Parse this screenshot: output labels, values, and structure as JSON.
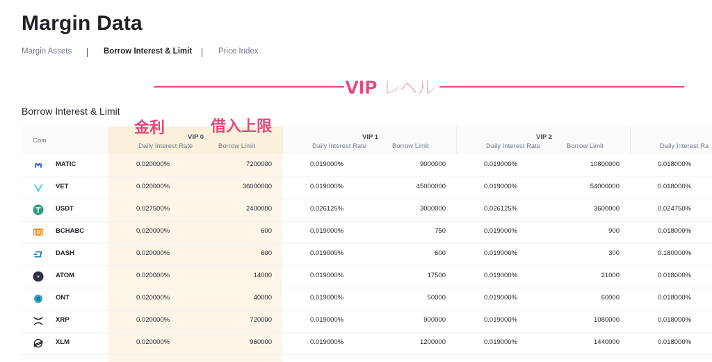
{
  "page": {
    "title": "Margin Data"
  },
  "subnav": [
    {
      "label": "Margin Assets",
      "active": false
    },
    {
      "label": "Borrow Interest & Limit",
      "active": true
    },
    {
      "label": "Price Index",
      "active": false
    }
  ],
  "annotations": {
    "vip_level": "VIP レベル",
    "interest": "金利",
    "borrow_limit": "借入上限",
    "color": "#e8467c"
  },
  "section": {
    "title": "Borrow Interest & Limit"
  },
  "table": {
    "coin_header": "Coin",
    "tiers": [
      {
        "name": "VIP 0",
        "rate_label": "Daily Interest Rate",
        "limit_label": "Borrow Limit",
        "highlight_color": "#fdf6e8"
      },
      {
        "name": "VIP 1",
        "rate_label": "Daily Interest Rate",
        "limit_label": "Borrow Limit"
      },
      {
        "name": "VIP 2",
        "rate_label": "Daily Interest Rate",
        "limit_label": "Borrow Limit"
      },
      {
        "name": "",
        "rate_label": "Daily Interest Ra",
        "limit_label": ""
      }
    ],
    "rows": [
      {
        "coin": "MATIC",
        "icon": "matic-icon",
        "color": "#2b6def",
        "vip0_rate": "0.020000%",
        "vip0_limit": "7200000",
        "vip1_rate": "0.019000%",
        "vip1_limit": "9000000",
        "vip2_rate": "0.019000%",
        "vip2_limit": "10800000",
        "vip3_rate": "0.018000%"
      },
      {
        "coin": "VET",
        "icon": "vet-icon",
        "color": "#15bdff",
        "vip0_rate": "0.020000%",
        "vip0_limit": "36000000",
        "vip1_rate": "0.019000%",
        "vip1_limit": "45000000",
        "vip2_rate": "0.019000%",
        "vip2_limit": "54000000",
        "vip3_rate": "0.018000%"
      },
      {
        "coin": "USDT",
        "icon": "usdt-icon",
        "color": "#26a17b",
        "vip0_rate": "0.027500%",
        "vip0_limit": "2400000",
        "vip1_rate": "0.026125%",
        "vip1_limit": "3000000",
        "vip2_rate": "0.026125%",
        "vip2_limit": "3600000",
        "vip3_rate": "0.024750%"
      },
      {
        "coin": "BCHABC",
        "icon": "bchabc-icon",
        "color": "#f0861a",
        "vip0_rate": "0.020000%",
        "vip0_limit": "600",
        "vip1_rate": "0.019000%",
        "vip1_limit": "750",
        "vip2_rate": "0.019000%",
        "vip2_limit": "900",
        "vip3_rate": "0.018000%"
      },
      {
        "coin": "DASH",
        "icon": "dash-icon",
        "color": "#1c75bc",
        "vip0_rate": "0.020000%",
        "vip0_limit": "600",
        "vip1_rate": "0.019000%",
        "vip1_limit": "600",
        "vip2_rate": "0.019000%",
        "vip2_limit": "300",
        "vip3_rate": "0.180000%"
      },
      {
        "coin": "ATOM",
        "icon": "atom-icon",
        "color": "#2e3148",
        "vip0_rate": "0.020000%",
        "vip0_limit": "14000",
        "vip1_rate": "0.019000%",
        "vip1_limit": "17500",
        "vip2_rate": "0.019000%",
        "vip2_limit": "21000",
        "vip3_rate": "0.018000%"
      },
      {
        "coin": "ONT",
        "icon": "ont-icon",
        "color": "#32a4be",
        "vip0_rate": "0.020000%",
        "vip0_limit": "40000",
        "vip1_rate": "0.019000%",
        "vip1_limit": "50000",
        "vip2_rate": "0.019000%",
        "vip2_limit": "60000",
        "vip3_rate": "0.018000%"
      },
      {
        "coin": "XRP",
        "icon": "xrp-icon",
        "color": "#23292f",
        "vip0_rate": "0.020000%",
        "vip0_limit": "720000",
        "vip1_rate": "0.019000%",
        "vip1_limit": "900000",
        "vip2_rate": "0.019000%",
        "vip2_limit": "1080000",
        "vip3_rate": "0.018000%"
      },
      {
        "coin": "XLM",
        "icon": "xlm-icon",
        "color": "#14181b",
        "vip0_rate": "0.020000%",
        "vip0_limit": "960000",
        "vip1_rate": "0.019000%",
        "vip1_limit": "1200000",
        "vip2_rate": "0.019000%",
        "vip2_limit": "1440000",
        "vip3_rate": "0.018000%"
      }
    ]
  }
}
